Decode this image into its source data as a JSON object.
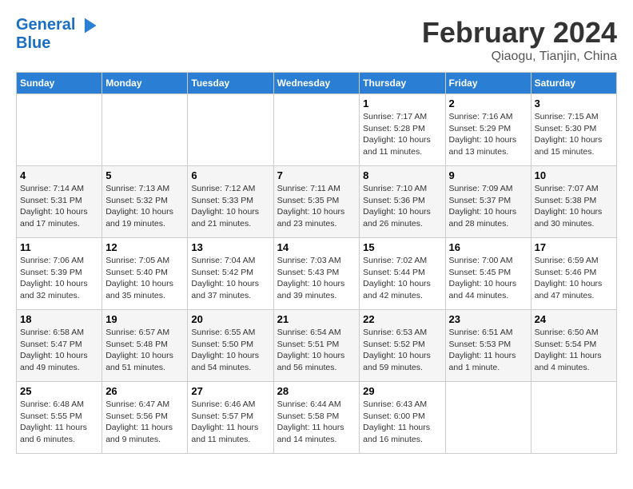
{
  "header": {
    "logo_general": "General",
    "logo_blue": "Blue",
    "month": "February 2024",
    "location": "Qiaogu, Tianjin, China"
  },
  "weekdays": [
    "Sunday",
    "Monday",
    "Tuesday",
    "Wednesday",
    "Thursday",
    "Friday",
    "Saturday"
  ],
  "weeks": [
    [
      {
        "day": "",
        "info": ""
      },
      {
        "day": "",
        "info": ""
      },
      {
        "day": "",
        "info": ""
      },
      {
        "day": "",
        "info": ""
      },
      {
        "day": "1",
        "info": "Sunrise: 7:17 AM\nSunset: 5:28 PM\nDaylight: 10 hours\nand 11 minutes."
      },
      {
        "day": "2",
        "info": "Sunrise: 7:16 AM\nSunset: 5:29 PM\nDaylight: 10 hours\nand 13 minutes."
      },
      {
        "day": "3",
        "info": "Sunrise: 7:15 AM\nSunset: 5:30 PM\nDaylight: 10 hours\nand 15 minutes."
      }
    ],
    [
      {
        "day": "4",
        "info": "Sunrise: 7:14 AM\nSunset: 5:31 PM\nDaylight: 10 hours\nand 17 minutes."
      },
      {
        "day": "5",
        "info": "Sunrise: 7:13 AM\nSunset: 5:32 PM\nDaylight: 10 hours\nand 19 minutes."
      },
      {
        "day": "6",
        "info": "Sunrise: 7:12 AM\nSunset: 5:33 PM\nDaylight: 10 hours\nand 21 minutes."
      },
      {
        "day": "7",
        "info": "Sunrise: 7:11 AM\nSunset: 5:35 PM\nDaylight: 10 hours\nand 23 minutes."
      },
      {
        "day": "8",
        "info": "Sunrise: 7:10 AM\nSunset: 5:36 PM\nDaylight: 10 hours\nand 26 minutes."
      },
      {
        "day": "9",
        "info": "Sunrise: 7:09 AM\nSunset: 5:37 PM\nDaylight: 10 hours\nand 28 minutes."
      },
      {
        "day": "10",
        "info": "Sunrise: 7:07 AM\nSunset: 5:38 PM\nDaylight: 10 hours\nand 30 minutes."
      }
    ],
    [
      {
        "day": "11",
        "info": "Sunrise: 7:06 AM\nSunset: 5:39 PM\nDaylight: 10 hours\nand 32 minutes."
      },
      {
        "day": "12",
        "info": "Sunrise: 7:05 AM\nSunset: 5:40 PM\nDaylight: 10 hours\nand 35 minutes."
      },
      {
        "day": "13",
        "info": "Sunrise: 7:04 AM\nSunset: 5:42 PM\nDaylight: 10 hours\nand 37 minutes."
      },
      {
        "day": "14",
        "info": "Sunrise: 7:03 AM\nSunset: 5:43 PM\nDaylight: 10 hours\nand 39 minutes."
      },
      {
        "day": "15",
        "info": "Sunrise: 7:02 AM\nSunset: 5:44 PM\nDaylight: 10 hours\nand 42 minutes."
      },
      {
        "day": "16",
        "info": "Sunrise: 7:00 AM\nSunset: 5:45 PM\nDaylight: 10 hours\nand 44 minutes."
      },
      {
        "day": "17",
        "info": "Sunrise: 6:59 AM\nSunset: 5:46 PM\nDaylight: 10 hours\nand 47 minutes."
      }
    ],
    [
      {
        "day": "18",
        "info": "Sunrise: 6:58 AM\nSunset: 5:47 PM\nDaylight: 10 hours\nand 49 minutes."
      },
      {
        "day": "19",
        "info": "Sunrise: 6:57 AM\nSunset: 5:48 PM\nDaylight: 10 hours\nand 51 minutes."
      },
      {
        "day": "20",
        "info": "Sunrise: 6:55 AM\nSunset: 5:50 PM\nDaylight: 10 hours\nand 54 minutes."
      },
      {
        "day": "21",
        "info": "Sunrise: 6:54 AM\nSunset: 5:51 PM\nDaylight: 10 hours\nand 56 minutes."
      },
      {
        "day": "22",
        "info": "Sunrise: 6:53 AM\nSunset: 5:52 PM\nDaylight: 10 hours\nand 59 minutes."
      },
      {
        "day": "23",
        "info": "Sunrise: 6:51 AM\nSunset: 5:53 PM\nDaylight: 11 hours\nand 1 minute."
      },
      {
        "day": "24",
        "info": "Sunrise: 6:50 AM\nSunset: 5:54 PM\nDaylight: 11 hours\nand 4 minutes."
      }
    ],
    [
      {
        "day": "25",
        "info": "Sunrise: 6:48 AM\nSunset: 5:55 PM\nDaylight: 11 hours\nand 6 minutes."
      },
      {
        "day": "26",
        "info": "Sunrise: 6:47 AM\nSunset: 5:56 PM\nDaylight: 11 hours\nand 9 minutes."
      },
      {
        "day": "27",
        "info": "Sunrise: 6:46 AM\nSunset: 5:57 PM\nDaylight: 11 hours\nand 11 minutes."
      },
      {
        "day": "28",
        "info": "Sunrise: 6:44 AM\nSunset: 5:58 PM\nDaylight: 11 hours\nand 14 minutes."
      },
      {
        "day": "29",
        "info": "Sunrise: 6:43 AM\nSunset: 6:00 PM\nDaylight: 11 hours\nand 16 minutes."
      },
      {
        "day": "",
        "info": ""
      },
      {
        "day": "",
        "info": ""
      }
    ]
  ]
}
